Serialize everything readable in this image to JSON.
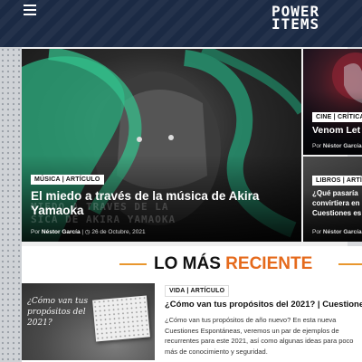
{
  "header": {
    "logo_line1": "POWER",
    "logo_line2": "ITEMS"
  },
  "hero": {
    "category": "MÚSICA | ARTÍCULO",
    "title": "El miedo a través de la música de Akira Yamaoka",
    "author": "Néstor García",
    "date": "26 de Octubre, 2021",
    "image_text_line1": "MIEDO A TRAVES DE LA",
    "image_text_line2": "SICA DE AKIRA YAMAOKA"
  },
  "side_cards": [
    {
      "category": "CINE | CRÍTICA",
      "title": "Venom Let",
      "author": "Néstor García"
    },
    {
      "category": "LIBROS | ARTÍ",
      "title_line1": "¿Qué pasaría",
      "title_line2": "convirtiera en",
      "title_line3": "Cuestiones es",
      "author": "Néstor García"
    }
  ],
  "section": {
    "title_main": "LO MÁS ",
    "title_accent": "RECIENTE"
  },
  "latest_post": {
    "thumb_text": "¿Cómo van tus propósitos del 2021?",
    "category": "VIDA | ARTÍCULO",
    "title": "¿Cómo van tus propósitos del 2021? | Cuestione",
    "excerpt": "¿Cómo van tus propósitos de año nuevo? En esta nueva Cuestiones Espontáneas, veremos un par de ejemplos de recurrentes para este 2021, así como algunas ideas para poco más de conocimiento y seguridad."
  },
  "colors": {
    "header_bg": "#1b2a44",
    "accent": "#e56a1c",
    "rule": "#e8962e"
  }
}
